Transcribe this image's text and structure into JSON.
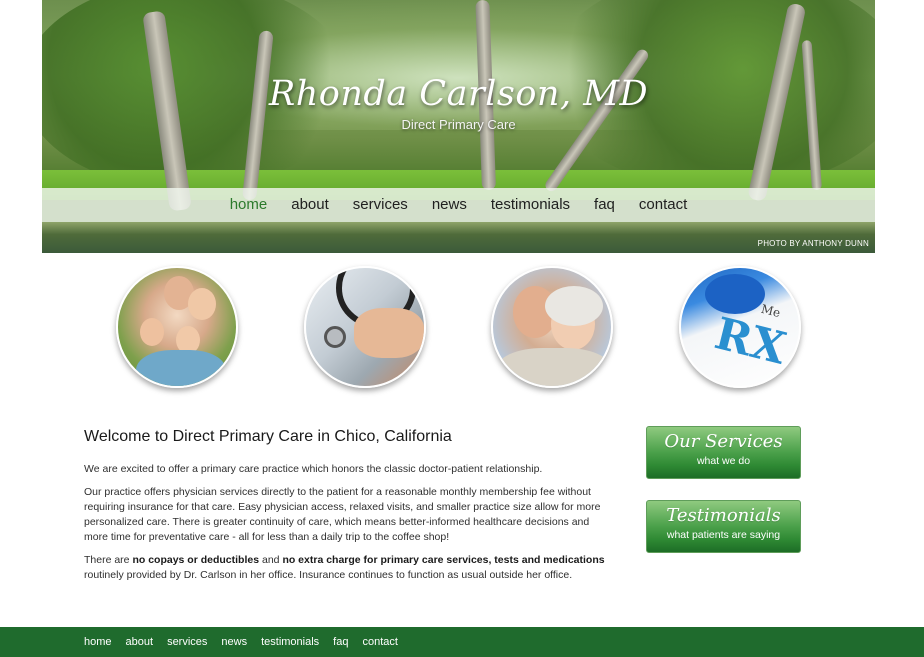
{
  "header": {
    "title": "Rhonda Carlson, MD",
    "subtitle": "Direct Primary Care",
    "photo_credit": "PHOTO BY ANTHONY DUNN"
  },
  "nav": {
    "items": [
      {
        "label": "home",
        "active": true
      },
      {
        "label": "about",
        "active": false
      },
      {
        "label": "services",
        "active": false
      },
      {
        "label": "news",
        "active": false
      },
      {
        "label": "testimonials",
        "active": false
      },
      {
        "label": "faq",
        "active": false
      },
      {
        "label": "contact",
        "active": false
      }
    ]
  },
  "photos": [
    {
      "icon": "family-photo"
    },
    {
      "icon": "stethoscope-photo"
    },
    {
      "icon": "senior-couple-photo"
    },
    {
      "icon": "prescription-rx-photo",
      "rx_text": "RX",
      "med_text": "Me"
    }
  ],
  "main": {
    "heading": "Welcome to Direct Primary Care in Chico, California",
    "para1": "We are excited to offer a primary care practice which honors the classic doctor-patient relationship.",
    "para2": "Our practice offers physician services directly to the patient for a reasonable monthly membership fee without requiring insurance for that care. Easy physician access, relaxed visits, and smaller practice size allow for more personalized care. There is greater continuity of care, which means better-informed healthcare decisions and more time for preventative care - all for less than a daily trip to the coffee shop!",
    "para3": {
      "t1": "There are ",
      "b1": "no copays or deductibles",
      "t2": " and ",
      "b2": "no extra charge for primary care services, tests and medications",
      "t3": " routinely provided by Dr. Carlson in her office. Insurance continues to function as usual outside her office."
    }
  },
  "sidebar": {
    "services": {
      "title": "Our Services",
      "subtitle": "what we do"
    },
    "testimonials": {
      "title": "Testimonials",
      "subtitle": "what patients are saying"
    }
  },
  "footer": {
    "items": [
      "home",
      "about",
      "services",
      "news",
      "testimonials",
      "faq",
      "contact"
    ]
  },
  "colors": {
    "accent_green": "#2c7a2c",
    "footer_green": "#1f6b2d",
    "button_green": "#4aa04a"
  }
}
